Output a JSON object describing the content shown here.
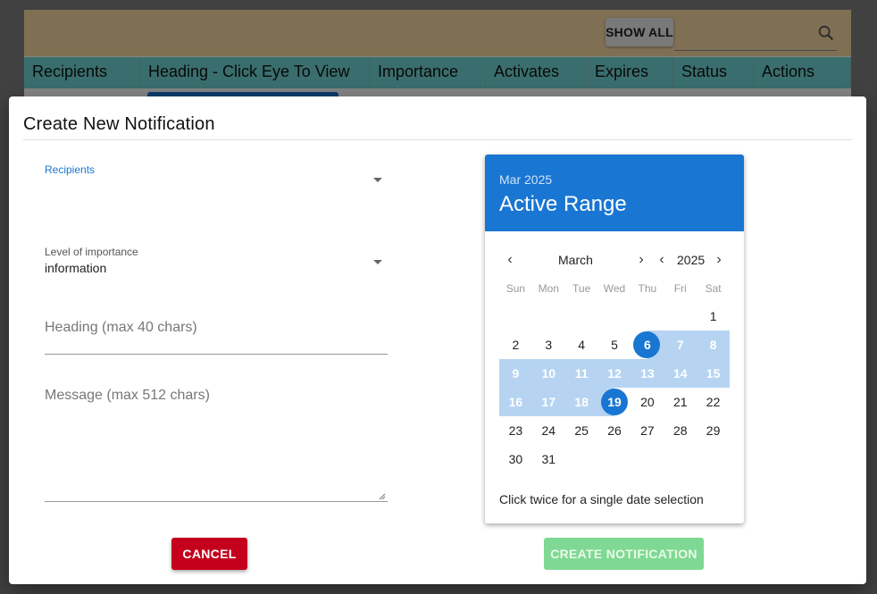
{
  "background": {
    "show_all_label": "SHOW ALL",
    "columns": [
      "Recipients",
      "Heading - Click Eye To View",
      "Importance",
      "Activates",
      "Expires",
      "Status",
      "Actions"
    ]
  },
  "dialog": {
    "title": "Create New Notification",
    "recipients_label": "Recipients",
    "recipients_value": "",
    "importance_label": "Level of importance",
    "importance_value": "information",
    "heading_placeholder": "Heading (max 40 chars)",
    "message_placeholder": "Message (max 512 chars)",
    "cancel_label": "CANCEL",
    "create_label": "CREATE NOTIFICATION"
  },
  "calendar": {
    "header_sub": "Mar 2025",
    "header_title": "Active Range",
    "month": "March",
    "year": "2025",
    "weekdays": [
      "Sun",
      "Mon",
      "Tue",
      "Wed",
      "Thu",
      "Fri",
      "Sat"
    ],
    "weeks": [
      [
        "",
        "",
        "",
        "",
        "",
        "",
        "1"
      ],
      [
        "2",
        "3",
        "4",
        "5",
        "6",
        "7",
        "8"
      ],
      [
        "9",
        "10",
        "11",
        "12",
        "13",
        "14",
        "15"
      ],
      [
        "16",
        "17",
        "18",
        "19",
        "20",
        "21",
        "22"
      ],
      [
        "23",
        "24",
        "25",
        "26",
        "27",
        "28",
        "29"
      ],
      [
        "30",
        "31",
        "",
        "",
        "",
        "",
        ""
      ]
    ],
    "range_start": "6",
    "range_end": "19",
    "hint": "Click twice for a single date selection",
    "colors": {
      "accent": "#1976d2",
      "range": "#b6d4f2"
    }
  }
}
